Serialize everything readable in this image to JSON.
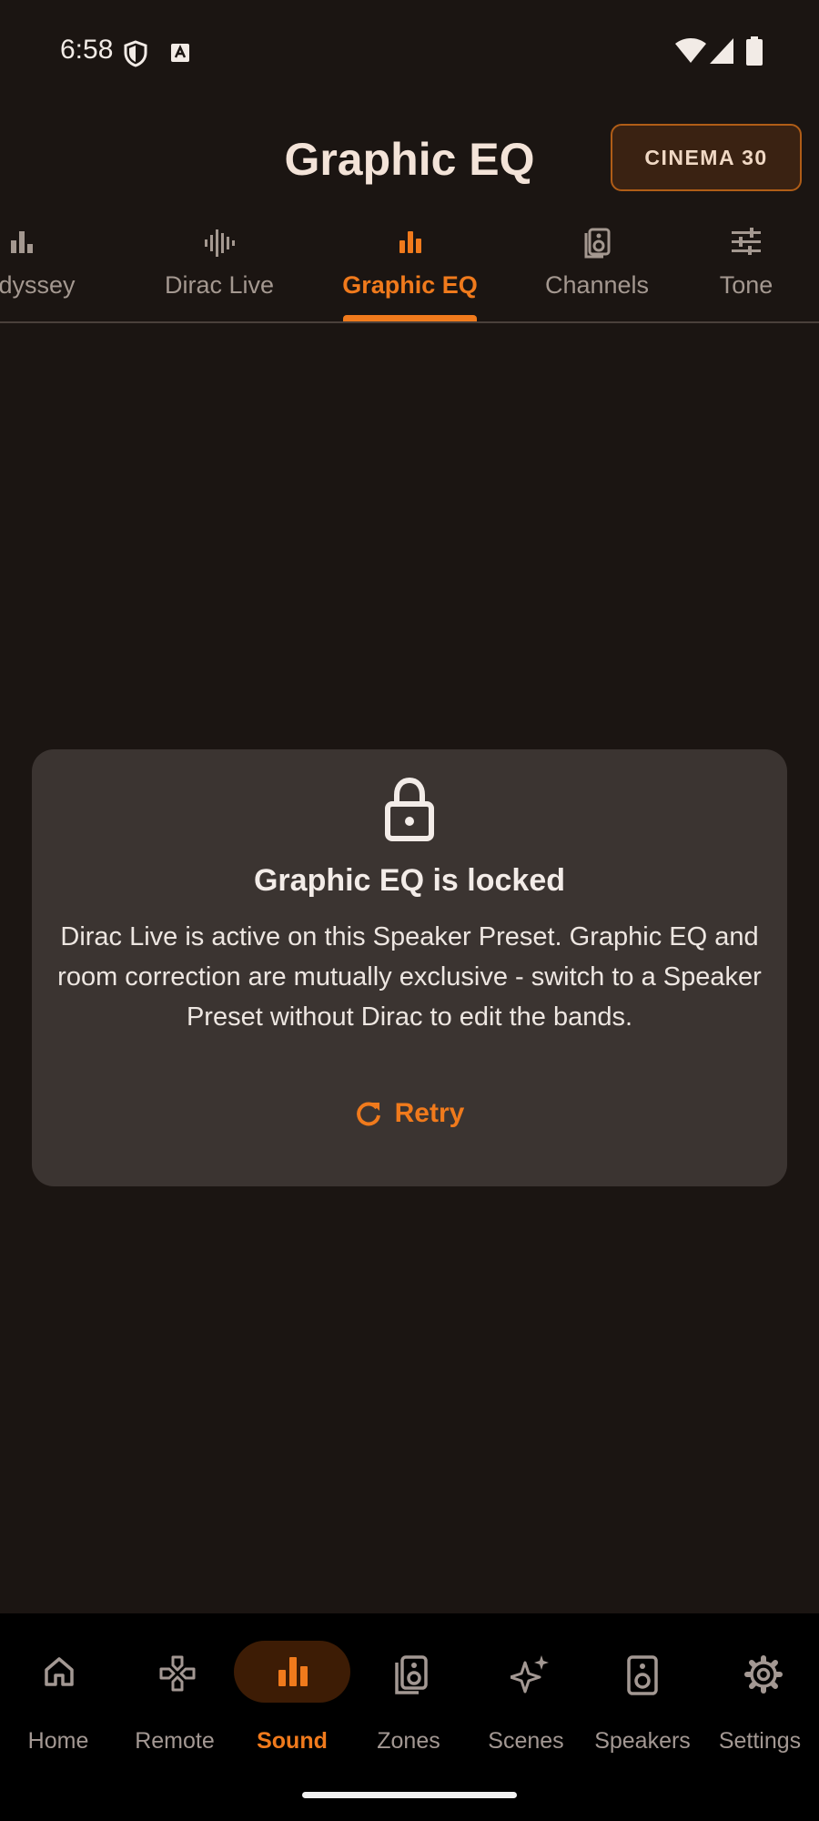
{
  "status_bar": {
    "time": "6:58",
    "left_icons": [
      "shield-icon",
      "text-a-icon"
    ],
    "right_icons": [
      "wifi-icon",
      "cellular-icon",
      "battery-icon"
    ]
  },
  "header": {
    "title": "Graphic EQ",
    "preset_chip": "CINEMA 30"
  },
  "tabs": [
    {
      "label": "Audyssey",
      "icon": "bar-chart-icon",
      "active": false
    },
    {
      "label": "Dirac Live",
      "icon": "waveform-icon",
      "active": false
    },
    {
      "label": "Graphic EQ",
      "icon": "equalizer-icon",
      "active": true
    },
    {
      "label": "Channels",
      "icon": "speaker-stack-icon",
      "active": false
    },
    {
      "label": "Tone",
      "icon": "tune-icon",
      "active": false
    }
  ],
  "locked_card": {
    "icon": "lock-icon",
    "title": "Graphic EQ is locked",
    "message": "Dirac Live is active on this Speaker Preset. Graphic EQ and room correction are mutually exclusive - switch to a Speaker Preset without Dirac to edit the bands.",
    "retry_label": "Retry"
  },
  "bottom_nav": [
    {
      "label": "Home",
      "icon": "home-icon",
      "active": false
    },
    {
      "label": "Remote",
      "icon": "gamepad-icon",
      "active": false
    },
    {
      "label": "Sound",
      "icon": "equalizer-icon",
      "active": true
    },
    {
      "label": "Zones",
      "icon": "speaker-stack-icon",
      "active": false
    },
    {
      "label": "Scenes",
      "icon": "sparkles-icon",
      "active": false
    },
    {
      "label": "Speakers",
      "icon": "speaker-icon",
      "active": false
    },
    {
      "label": "Settings",
      "icon": "gear-icon",
      "active": false
    }
  ],
  "colors": {
    "background": "#1b1512",
    "accent": "#f07a1c",
    "card": "#3b3431",
    "navbar": "#000000"
  }
}
